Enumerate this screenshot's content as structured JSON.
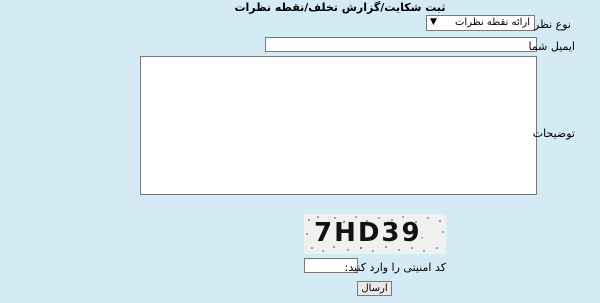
{
  "form": {
    "title": "ثبت شکایت/گزارش تخلف/نقطه نظرات",
    "type_label": "نوع نظر",
    "type_selected": "ارائه نقطه نظرات",
    "email_label": "ایمیل شما",
    "email_value": "",
    "description_label": "توضیحات",
    "description_value": "",
    "captcha_text": "7HD39",
    "captcha_label": "کد امنیتی را وارد کنید:",
    "captcha_value": "",
    "submit_label": "ارسال"
  },
  "icons": {
    "select_arrow": "▼"
  }
}
